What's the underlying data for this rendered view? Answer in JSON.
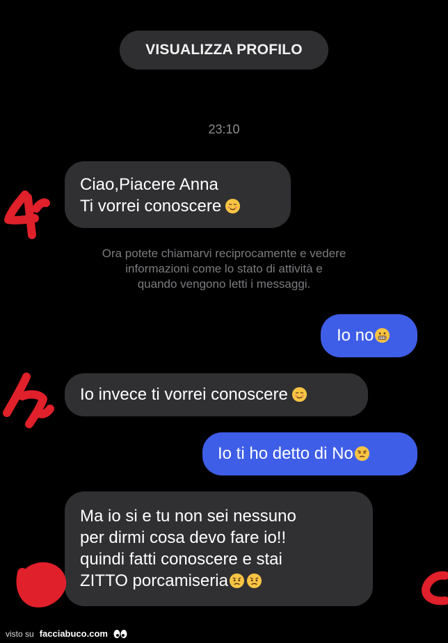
{
  "header": {
    "profile_button": "VISUALIZZA PROFILO",
    "timestamp": "23:10"
  },
  "messages": [
    {
      "sender": "other",
      "lines": [
        "Ciao,Piacere Anna",
        "Ti vorrei conoscere"
      ],
      "emoji": "smiling-blushing-icon"
    },
    {
      "sender": "me",
      "lines": [
        "Io no"
      ],
      "emoji": "grimacing-icon"
    },
    {
      "sender": "other",
      "lines": [
        "Io invece ti vorrei conoscere"
      ],
      "emoji": "smiling-blushing-icon"
    },
    {
      "sender": "me",
      "lines": [
        "Io ti ho detto di No"
      ],
      "emoji": "unamused-icon"
    },
    {
      "sender": "other",
      "lines": [
        "Ma io si e tu non sei nessuno",
        "per dirmi cosa devo fare io!!",
        "quindi fatti conoscere e stai",
        "ZITTO porcamiseria"
      ],
      "emoji": "frowning-icon"
    }
  ],
  "notice": [
    "Ora potete chiamarvi reciprocamente e vedere",
    "informazioni come lo stato di attività e",
    "quando vengono letti i messaggi."
  ],
  "footer": {
    "prefix": "visto su",
    "brand": "facciabuco.com"
  },
  "colors": {
    "background": "#000000",
    "incoming_bubble": "#303033",
    "outgoing_bubble": "#3f5ee8",
    "annotation_red": "#e0202a"
  }
}
